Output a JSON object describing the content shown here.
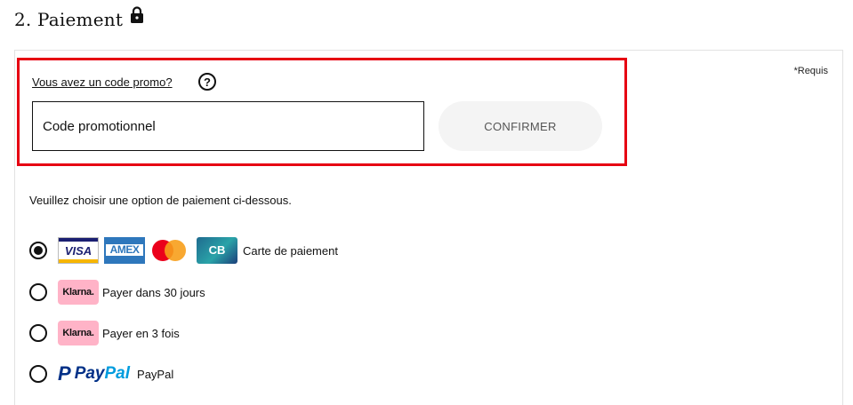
{
  "section": {
    "title": "2. Paiement",
    "lock_icon": "lock-icon"
  },
  "required_note": "*Requis",
  "promo": {
    "link_text": "Vous avez un code promo?",
    "help_icon_glyph": "?",
    "input_placeholder": "Code promotionnel",
    "input_value": "",
    "confirm_label": "CONFIRMER",
    "highlight_color": "#e60012"
  },
  "instructions": "Veuillez choisir une option de paiement ci-dessous.",
  "payment_options": [
    {
      "label": "Carte de paiement",
      "selected": true,
      "logos": [
        "VISA",
        "AMEX",
        "mastercard",
        "CB"
      ]
    },
    {
      "label": "Payer dans 30 jours",
      "selected": false,
      "logos": [
        "Klarna."
      ]
    },
    {
      "label": "Payer en 3 fois",
      "selected": false,
      "logos": [
        "Klarna."
      ]
    },
    {
      "label": "PayPal",
      "selected": false,
      "logos": [
        "PayPal"
      ]
    }
  ],
  "logo_text": {
    "visa": "VISA",
    "amex": "AMEX",
    "cb": "CB",
    "klarna": "Klarna.",
    "paypal_p": "P",
    "paypal_pay": "Pay",
    "paypal_pal": "Pal"
  },
  "colors": {
    "klarna_pink": "#ffb3c7",
    "paypal_dark": "#003087",
    "paypal_light": "#009cde",
    "visa_blue": "#1a1f71"
  }
}
